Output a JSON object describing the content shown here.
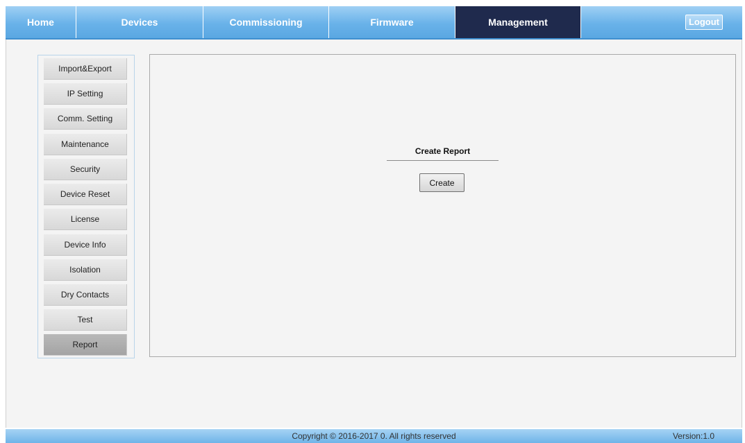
{
  "nav": {
    "tabs": [
      {
        "label": "Home"
      },
      {
        "label": "Devices"
      },
      {
        "label": "Commissioning"
      },
      {
        "label": "Firmware"
      },
      {
        "label": "Management",
        "active": true
      }
    ],
    "logout_label": "Logout"
  },
  "sidebar": {
    "items": [
      {
        "label": "Import&Export"
      },
      {
        "label": "IP Setting"
      },
      {
        "label": "Comm. Setting"
      },
      {
        "label": "Maintenance"
      },
      {
        "label": "Security"
      },
      {
        "label": "Device Reset"
      },
      {
        "label": "License"
      },
      {
        "label": "Device Info"
      },
      {
        "label": "Isolation"
      },
      {
        "label": "Dry Contacts"
      },
      {
        "label": "Test"
      },
      {
        "label": "Report",
        "active": true
      }
    ]
  },
  "content": {
    "title": "Create Report",
    "create_button_label": "Create"
  },
  "footer": {
    "copyright": "Copyright © 2016-2017 0. All rights reserved",
    "version": "Version:1.0"
  },
  "colors": {
    "nav_bar": "#69b2e9",
    "active_tab": "#1f2a4d",
    "footer_bar": "#6fb4e8",
    "content_bg": "#f4f4f4"
  }
}
